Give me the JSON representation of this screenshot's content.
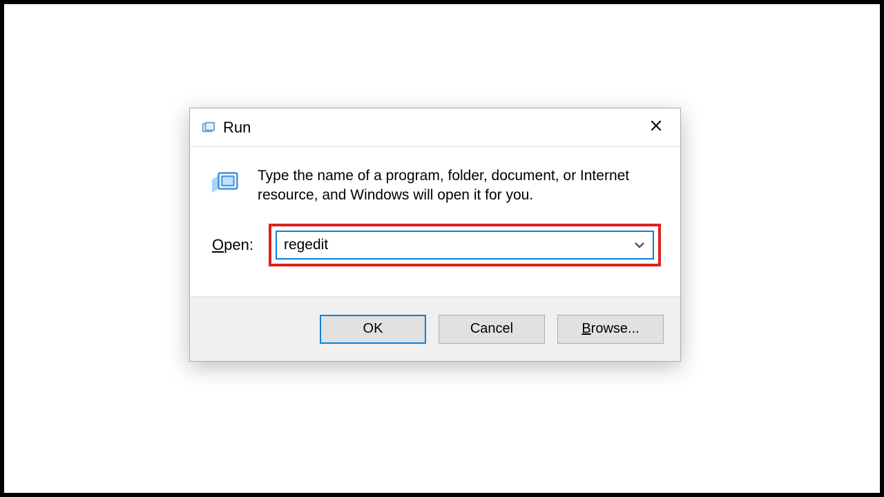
{
  "dialog": {
    "title": "Run",
    "instruction": "Type the name of a program, folder, document, or Internet resource, and Windows will open it for you.",
    "open_label_letter": "O",
    "open_label_rest": "pen:",
    "input_value": "regedit",
    "buttons": {
      "ok": "OK",
      "cancel": "Cancel",
      "browse_letter": "B",
      "browse_rest": "rowse..."
    }
  }
}
